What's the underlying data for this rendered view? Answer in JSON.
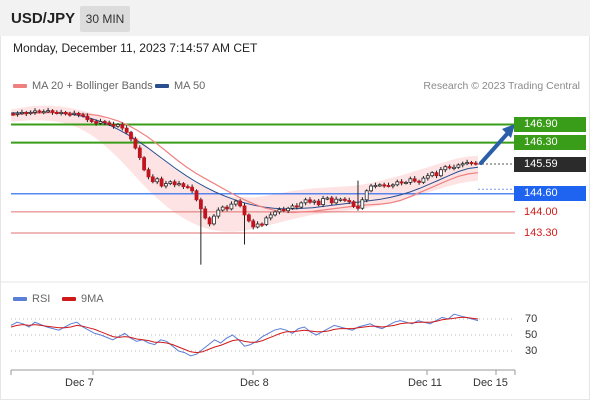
{
  "header": {
    "symbol": "USD/JPY",
    "timeframe": "30 MIN"
  },
  "datetime": "Monday, December 11, 2023 7:14:57 AM CET",
  "legend_main": {
    "ma20_label": "MA 20 + Bollinger Bands",
    "ma50_label": "MA 50"
  },
  "credit": "Research © 2023 Trading Central",
  "legend_rsi": {
    "rsi_label": "RSI",
    "ma9_label": "9MA"
  },
  "levels": [
    {
      "value": "146.90",
      "kind": "resistance",
      "color": "#3a9d1a"
    },
    {
      "value": "146.30",
      "kind": "resistance",
      "color": "#3a9d1a"
    },
    {
      "value": "145.59",
      "kind": "last",
      "color": "#2b2b2b"
    },
    {
      "value": "144.60",
      "kind": "pivot",
      "color": "#1e64f0"
    },
    {
      "value": "144.00",
      "kind": "support",
      "color": "#d01a1a"
    },
    {
      "value": "143.30",
      "kind": "support",
      "color": "#d01a1a"
    }
  ],
  "xaxis": {
    "labels": [
      "Dec 7",
      "Dec 8",
      "Dec 11",
      "Dec 15"
    ]
  },
  "rsi_axis": {
    "ticks": [
      "70",
      "50",
      "30"
    ]
  },
  "colors": {
    "bullish_candle": "#3a9d1a",
    "bearish_candle": "#c0141e",
    "ma20": "#f08080",
    "ma50": "#2a4f8f",
    "bollinger_band": "#fde3e3",
    "rsi": "#5b7fd6",
    "rsi_ma9": "#d01a1a",
    "forecast_arrow": "#2a5fa8"
  },
  "chart_data": [
    {
      "type": "candlestick",
      "title": "USD/JPY 30 MIN",
      "x_labels": [
        "Dec 7",
        "Dec 8",
        "Dec 11",
        "Dec 15"
      ],
      "ylim": [
        142.3,
        147.3
      ],
      "levels": [
        146.9,
        146.3,
        145.59,
        144.6,
        144.0,
        143.3
      ],
      "last_price": 145.59,
      "close": [
        147.24,
        147.27,
        147.3,
        147.26,
        147.3,
        147.35,
        147.32,
        147.33,
        147.36,
        147.3,
        147.28,
        147.3,
        147.25,
        147.24,
        147.27,
        147.22,
        147.18,
        147.06,
        147.0,
        146.94,
        147.0,
        146.96,
        146.9,
        146.84,
        146.9,
        146.78,
        146.64,
        146.42,
        146.12,
        145.8,
        145.4,
        145.16,
        145.0,
        145.1,
        144.86,
        144.94,
        145.0,
        144.9,
        144.94,
        144.84,
        144.82,
        144.7,
        144.4,
        144.1,
        143.8,
        143.6,
        143.86,
        144.06,
        144.16,
        144.1,
        144.26,
        144.36,
        144.2,
        143.9,
        143.7,
        143.5,
        143.6,
        143.58,
        143.8,
        143.9,
        144.0,
        144.08,
        144.04,
        144.12,
        144.2,
        144.16,
        144.3,
        144.4,
        144.32,
        144.36,
        144.24,
        144.44,
        144.46,
        144.3,
        144.42,
        144.42,
        144.38,
        144.34,
        144.18,
        144.12,
        144.4,
        144.7,
        144.86,
        144.88,
        144.9,
        144.88,
        144.86,
        144.9,
        145.0,
        144.96,
        144.98,
        145.1,
        145.02,
        144.98,
        145.12,
        145.2,
        145.3,
        145.2,
        145.4,
        145.5,
        145.46,
        145.48,
        145.56,
        145.6,
        145.64,
        145.62,
        145.59
      ],
      "ma20": [
        147.2,
        147.24,
        147.27,
        147.28,
        147.29,
        147.3,
        147.28,
        147.26,
        147.24,
        147.2,
        147.12,
        147.02,
        146.88,
        146.7,
        146.5,
        146.26,
        146.0,
        145.74,
        145.5,
        145.28,
        145.1,
        144.92,
        144.74,
        144.56,
        144.4,
        144.26,
        144.14,
        144.06,
        144.0,
        143.98,
        144.0,
        144.02,
        144.06,
        144.1,
        144.14,
        144.18,
        144.22,
        144.24,
        144.26,
        144.3,
        144.38,
        144.5,
        144.64,
        144.78,
        144.92,
        145.06,
        145.18,
        145.26,
        145.3
      ],
      "ma50": [
        147.28,
        147.29,
        147.3,
        147.3,
        147.3,
        147.28,
        147.25,
        147.2,
        147.12,
        147.02,
        146.9,
        146.74,
        146.56,
        146.36,
        146.14,
        145.9,
        145.66,
        145.42,
        145.2,
        145.0,
        144.82,
        144.66,
        144.52,
        144.4,
        144.3,
        144.22,
        144.16,
        144.12,
        144.1,
        144.1,
        144.12,
        144.14,
        144.18,
        144.22,
        144.26,
        144.3,
        144.34,
        144.38,
        144.42,
        144.48,
        144.56,
        144.66,
        144.78,
        144.92,
        145.06,
        145.2,
        145.34,
        145.44,
        145.48
      ],
      "bollinger_upper": [
        147.4,
        147.45,
        147.5,
        147.52,
        147.52,
        147.5,
        147.45,
        147.38,
        147.3,
        147.2,
        147.06,
        146.9,
        146.7,
        146.46,
        146.2,
        145.92,
        145.64,
        145.38,
        145.16,
        144.96,
        144.8,
        144.66,
        144.56,
        144.5,
        144.48,
        144.48,
        144.52,
        144.58,
        144.64,
        144.7,
        144.74,
        144.78,
        144.8,
        144.82,
        144.84,
        144.86,
        144.9,
        144.96,
        145.04,
        145.12,
        145.2,
        145.3,
        145.4,
        145.5,
        145.6,
        145.7,
        145.78,
        145.84,
        145.86
      ],
      "bollinger_lower": [
        147.0,
        147.02,
        147.04,
        147.04,
        147.02,
        146.98,
        146.9,
        146.78,
        146.6,
        146.38,
        146.1,
        145.8,
        145.46,
        145.1,
        144.76,
        144.46,
        144.18,
        143.94,
        143.74,
        143.58,
        143.46,
        143.38,
        143.34,
        143.34,
        143.38,
        143.44,
        143.52,
        143.6,
        143.68,
        143.76,
        143.84,
        143.9,
        143.94,
        143.98,
        144.02,
        144.06,
        144.1,
        144.16,
        144.22,
        144.3,
        144.38,
        144.46,
        144.56,
        144.66,
        144.76,
        144.86,
        144.94,
        145.0,
        145.04
      ]
    },
    {
      "type": "line",
      "title": "RSI",
      "series": [
        {
          "name": "RSI",
          "values": [
            62,
            66,
            64,
            60,
            66,
            63,
            60,
            58,
            56,
            60,
            64,
            66,
            60,
            56,
            52,
            50,
            47,
            44,
            48,
            52,
            46,
            42,
            44,
            40,
            38,
            44,
            42,
            36,
            30,
            28,
            24,
            26,
            32,
            38,
            44,
            40,
            46,
            50,
            44,
            36,
            38,
            42,
            48,
            52,
            56,
            58,
            56,
            52,
            58,
            60,
            54,
            50,
            54,
            58,
            62,
            60,
            58,
            56,
            60,
            62,
            64,
            60,
            58,
            62,
            66,
            68,
            66,
            64,
            68,
            66,
            64,
            68,
            72,
            70,
            76,
            74,
            72,
            70,
            68
          ]
        },
        {
          "name": "9MA",
          "values": [
            60,
            62,
            63,
            62,
            63,
            62,
            61,
            60,
            59,
            59,
            60,
            62,
            61,
            59,
            57,
            54,
            51,
            48,
            47,
            48,
            47,
            45,
            44,
            43,
            41,
            41,
            40,
            38,
            35,
            32,
            29,
            28,
            29,
            32,
            35,
            37,
            40,
            43,
            44,
            42,
            41,
            41,
            43,
            46,
            49,
            52,
            54,
            54,
            55,
            56,
            55,
            54,
            54,
            55,
            57,
            58,
            58,
            58,
            59,
            60,
            61,
            61,
            60,
            61,
            62,
            64,
            65,
            65,
            66,
            66,
            66,
            67,
            69,
            70,
            71,
            72,
            72,
            71,
            70
          ]
        }
      ],
      "ylim": [
        0,
        100
      ],
      "ticks": [
        70,
        50,
        30
      ]
    }
  ]
}
